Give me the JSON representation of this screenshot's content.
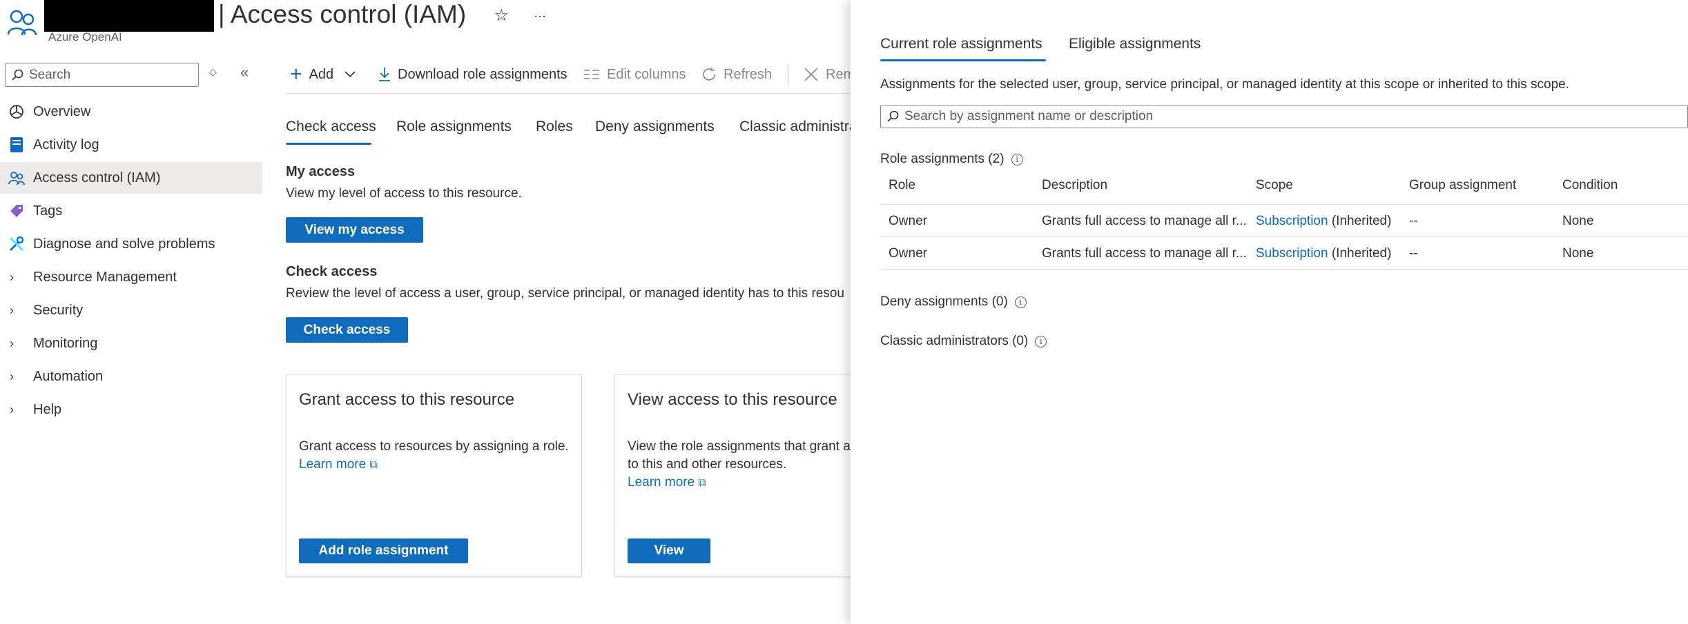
{
  "header": {
    "title": "| Access control (IAM)",
    "subtitle": "Azure OpenAI",
    "favorite_icon": "star-icon",
    "more_label": "···"
  },
  "sidebar": {
    "search_placeholder": "Search",
    "items": [
      {
        "label": "Overview",
        "icon": "openai-icon"
      },
      {
        "label": "Activity log",
        "icon": "activity-log-icon"
      },
      {
        "label": "Access control (IAM)",
        "icon": "iam-icon"
      },
      {
        "label": "Tags",
        "icon": "tag-icon"
      },
      {
        "label": "Diagnose and solve problems",
        "icon": "wrench-icon"
      },
      {
        "label": "Resource Management",
        "icon": "chevron-right-icon"
      },
      {
        "label": "Security",
        "icon": "chevron-right-icon"
      },
      {
        "label": "Monitoring",
        "icon": "chevron-right-icon"
      },
      {
        "label": "Automation",
        "icon": "chevron-right-icon"
      },
      {
        "label": "Help",
        "icon": "chevron-right-icon"
      }
    ]
  },
  "toolbar": {
    "add": "Add",
    "download": "Download role assignments",
    "edit_columns": "Edit columns",
    "refresh": "Refresh",
    "remove": "Rem"
  },
  "tabs": [
    "Check access",
    "Role assignments",
    "Roles",
    "Deny assignments",
    "Classic administra"
  ],
  "main": {
    "my_access_title": "My access",
    "my_access_text": "View my level of access to this resource.",
    "view_my_access_button": "View my access",
    "check_access_title": "Check access",
    "check_access_text": "Review the level of access a user, group, service principal, or managed identity has to this resou",
    "check_access_button": "Check access",
    "cards": [
      {
        "title": "Grant access to this resource",
        "text": "Grant access to resources by assigning a role.",
        "link": "Learn more",
        "button": "Add role assignment"
      },
      {
        "title": "View access to this resource",
        "text_line1": "View the role assignments that grant a",
        "text_line2": "to this and other resources.",
        "link": "Learn more",
        "button": "View"
      }
    ]
  },
  "panel": {
    "tabs": [
      "Current role assignments",
      "Eligible assignments"
    ],
    "description": "Assignments for the selected user, group, service principal, or managed identity at this scope or inherited to this scope.",
    "search_placeholder": "Search by assignment name or description",
    "role_assignments_label": "Role assignments (2)",
    "columns": [
      "Role",
      "Description",
      "Scope",
      "Group assignment",
      "Condition"
    ],
    "rows": [
      {
        "role": "Owner",
        "description": "Grants full access to manage all r...",
        "scope_link": "Subscription",
        "scope_suffix": "(Inherited)",
        "group": "--",
        "condition": "None"
      },
      {
        "role": "Owner",
        "description": "Grants full access to manage all r...",
        "scope_link": "Subscription",
        "scope_suffix": "(Inherited)",
        "group": "--",
        "condition": "None"
      }
    ],
    "deny_label": "Deny assignments (0)",
    "classic_label": "Classic administrators (0)"
  },
  "colors": {
    "accent": "#0f6cbd",
    "text": "#323130",
    "subtle": "#605e5c"
  }
}
